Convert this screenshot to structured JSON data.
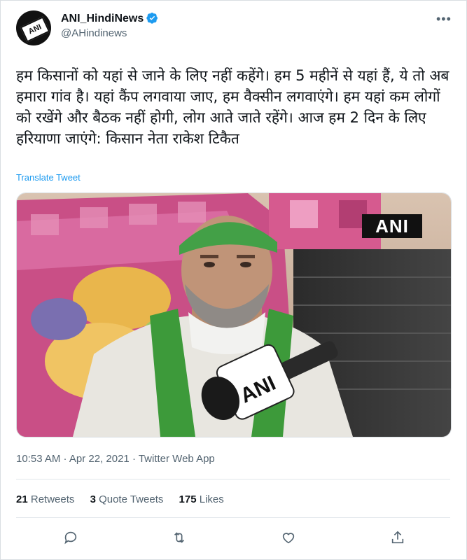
{
  "user": {
    "display_name": "ANI_HindiNews",
    "handle": "@AHindinews",
    "avatar_text": "ANI"
  },
  "tweet": {
    "text": "हम किसानों को यहां से जाने के लिए नहीं कहेंगे। हम 5 महीनें से यहां हैं, ये तो अब हमारा गांव है। यहां कैंप लगवाया जाए, हम वैक्सीन लगवाएंगे। हम यहां कम लोगों को रखेंगे और बैठक नहीं होगी, लोग आते जाते रहेंगे। आज हम 2 दिन के लिए हरियाणा जाएंगे: किसान नेता राकेश टिकैत",
    "translate_label": "Translate Tweet",
    "media_watermark": "ANI",
    "mic_label": "ANI",
    "timestamp": "10:53 AM · Apr 22, 2021 · Twitter Web App"
  },
  "stats": {
    "retweets_count": "21",
    "retweets_label": "Retweets",
    "quotes_count": "3",
    "quotes_label": "Quote Tweets",
    "likes_count": "175",
    "likes_label": "Likes"
  },
  "actions": [
    "reply-icon",
    "retweet-icon",
    "like-icon",
    "share-icon"
  ],
  "colors": {
    "accent": "#1d9bf0",
    "muted": "#536471",
    "text": "#0f1419"
  }
}
